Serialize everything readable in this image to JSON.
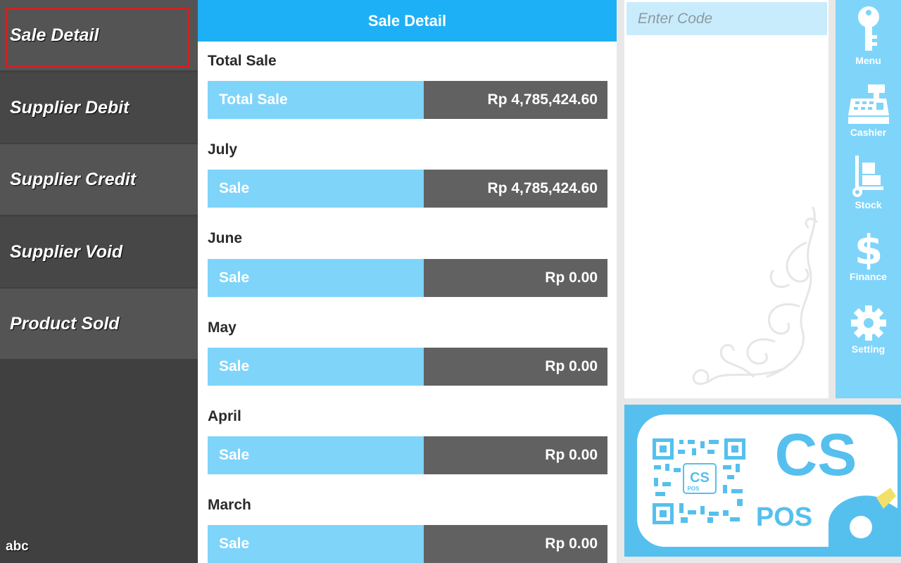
{
  "sidebar": {
    "items": [
      {
        "label": "Sale Detail"
      },
      {
        "label": "Supplier Debit"
      },
      {
        "label": "Supplier Credit"
      },
      {
        "label": "Supplier Void"
      },
      {
        "label": "Product Sold"
      }
    ],
    "user": "abc"
  },
  "main": {
    "header": "Sale Detail",
    "sections": [
      {
        "title": "Total Sale",
        "label": "Total Sale",
        "value": "Rp 4,785,424.60"
      },
      {
        "title": "July",
        "label": "Sale",
        "value": "Rp 4,785,424.60"
      },
      {
        "title": "June",
        "label": "Sale",
        "value": "Rp 0.00"
      },
      {
        "title": "May",
        "label": "Sale",
        "value": "Rp 0.00"
      },
      {
        "title": "April",
        "label": "Sale",
        "value": "Rp 0.00"
      },
      {
        "title": "March",
        "label": "Sale",
        "value": "Rp 0.00"
      }
    ]
  },
  "code_input": {
    "placeholder": "Enter Code"
  },
  "nav": [
    {
      "label": "Menu",
      "icon": "key-icon"
    },
    {
      "label": "Cashier",
      "icon": "cash-register-icon"
    },
    {
      "label": "Stock",
      "icon": "hand-truck-icon"
    },
    {
      "label": "Finance",
      "icon": "dollar-icon"
    },
    {
      "label": "Setting",
      "icon": "gear-icon"
    }
  ],
  "logo": {
    "big": "CS",
    "small": "POS",
    "qr_big": "CS",
    "qr_small": "POS"
  },
  "colors": {
    "accent": "#1eb0f6",
    "light_accent": "#7fd4fa",
    "value_bg": "#616161",
    "sidebar": "#404040",
    "selected_border": "#d42020"
  }
}
